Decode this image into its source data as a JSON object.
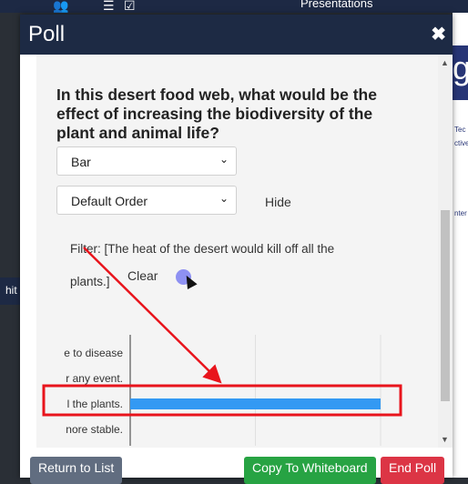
{
  "background": {
    "top_title": "Presentations",
    "left_fragment": "hit",
    "right_logo": "g",
    "right_texts": [
      "Tec",
      "ctive",
      "nter"
    ]
  },
  "modal": {
    "title": "Poll",
    "close_glyph": "✖",
    "question": "In this desert food web, what would be the effect of increasing the biodiversity of the plant and animal life?",
    "chart_type_select": "Bar",
    "order_select": "Default Order",
    "hide_label": "Hide",
    "filter_text": "Filter: [The heat of the desert would kill off all the plants.]",
    "clear_label": "Clear"
  },
  "chart_data": {
    "type": "bar",
    "orientation": "horizontal",
    "categories": [
      "e to disease",
      "r any event.",
      "l the plants.",
      "nore stable."
    ],
    "values": [
      0,
      0,
      1,
      0
    ],
    "xticks": [
      "0",
      "0.5",
      "1"
    ],
    "xlim": [
      0,
      1
    ],
    "bar_color": "#3399f3"
  },
  "footer": {
    "return_label": "Return to List",
    "copy_label": "Copy To Whiteboard",
    "end_label": "End Poll"
  },
  "annotation_color": "#e8141c"
}
